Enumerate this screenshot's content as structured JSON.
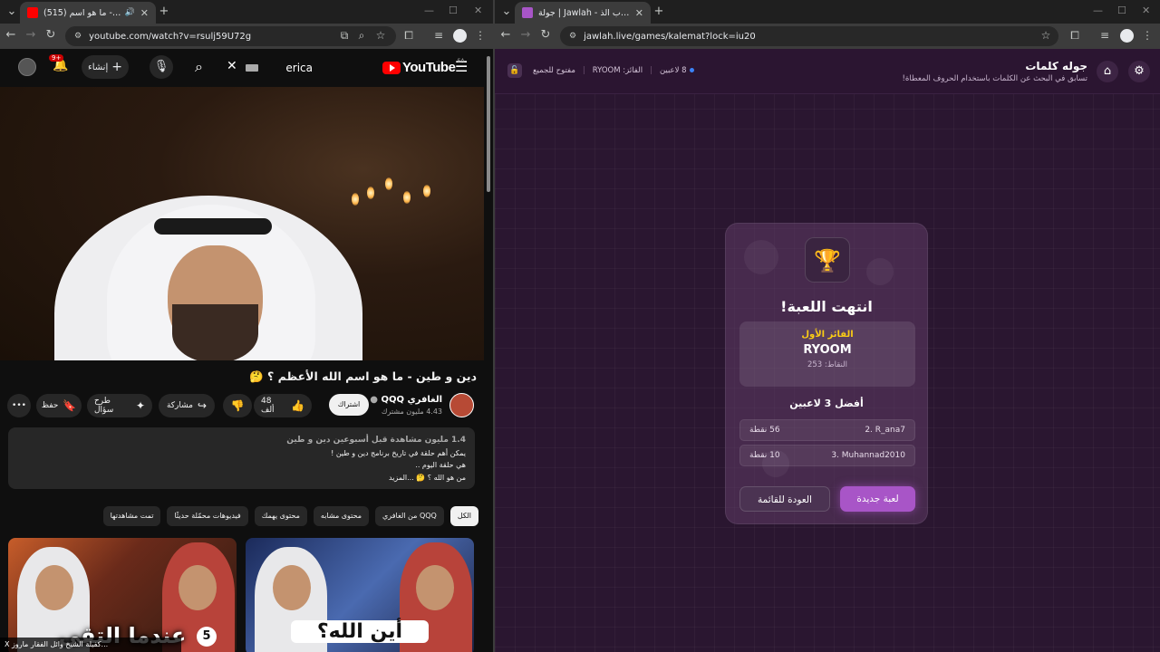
{
  "left_browser": {
    "tab_title": "(515) دين و طين - ما هو اسم ...",
    "url": "youtube.com/watch?v=rsulj59U72g"
  },
  "right_browser": {
    "tab_title": "جولة | Jawlah - منصة الألعاب الذ...",
    "url": "jawlah.live/games/kalemat?lock=iu20"
  },
  "youtube": {
    "logo": "YouTube",
    "country_code": "SA",
    "search_query": "erica",
    "create_label": "إنشاء",
    "notification_count": "9+",
    "video_title": "دين و طين - ما هو اسم الله الأعظم ؟ 🤔",
    "channel_name": "الغافري QQQ",
    "channel_subs": "4.43 مليون مشترك",
    "subscribe_label": "اشتراك",
    "likes": "48 ألف",
    "share_label": "مشاركة",
    "ask_label": "طرح سؤال",
    "save_label": "حفظ",
    "more_label": "•••",
    "description": {
      "stats": "1.4 مليون مشاهدة  قبل أسبوعين  دين و طين",
      "line1": "يمكن أهم حلقة في تاريخ برنامج دين و طين !",
      "line2": "هي حلقة اليوم ..",
      "line3": "من هو الله ؟ 🤔 ...المزيد"
    },
    "chips": [
      "الكل",
      "من الغافري QQQ",
      "محتوى مشابه",
      "محتوى يهمك",
      "فيديوهات محمّلة حديثًا",
      "تمت مشاهدتها"
    ],
    "thumbnails": [
      {
        "caption": "عندما التقى",
        "number": "5"
      },
      {
        "caption": "أين الله؟"
      }
    ],
    "bottom_tip": "X كفيلة الشيخ وائل الفقار ماروز..."
  },
  "jawlah": {
    "title": "جوله كلمات",
    "subtitle": "تسابق في البحث عن الكلمات باستخدام الحروف المعطاة!",
    "players": "8 لاعبين",
    "winner_header": "الفائز: RYOOM",
    "open_label": "مفتوح للجميع",
    "game_over": "انتهت اللعبة!",
    "first_winner_label": "الفائز الأول",
    "winner_name": "RYOOM",
    "winner_points": "النقاط: 253",
    "top3_title": "أفضل 3 لاعبين",
    "leaderboard": [
      {
        "name": "2. R_ana7",
        "points": "56 نقطة"
      },
      {
        "name": "3. Muhannad2010",
        "points": "10 نقطة"
      }
    ],
    "new_game_label": "لعبة جديدة",
    "back_label": "العودة للقائمة"
  },
  "colors": {
    "youtube_red": "#ff0000",
    "jawlah_bg": "#2a1630",
    "jawlah_accent": "#a855c7",
    "winner_gold": "#facc15"
  },
  "icons": [
    "menu-icon",
    "search-icon",
    "mic-icon",
    "bell-icon",
    "plus-icon",
    "like-icon",
    "dislike-icon",
    "share-icon",
    "sparkle-icon",
    "bookmark-icon",
    "gear-icon",
    "home-icon",
    "trophy-icon",
    "lock-icon"
  ]
}
